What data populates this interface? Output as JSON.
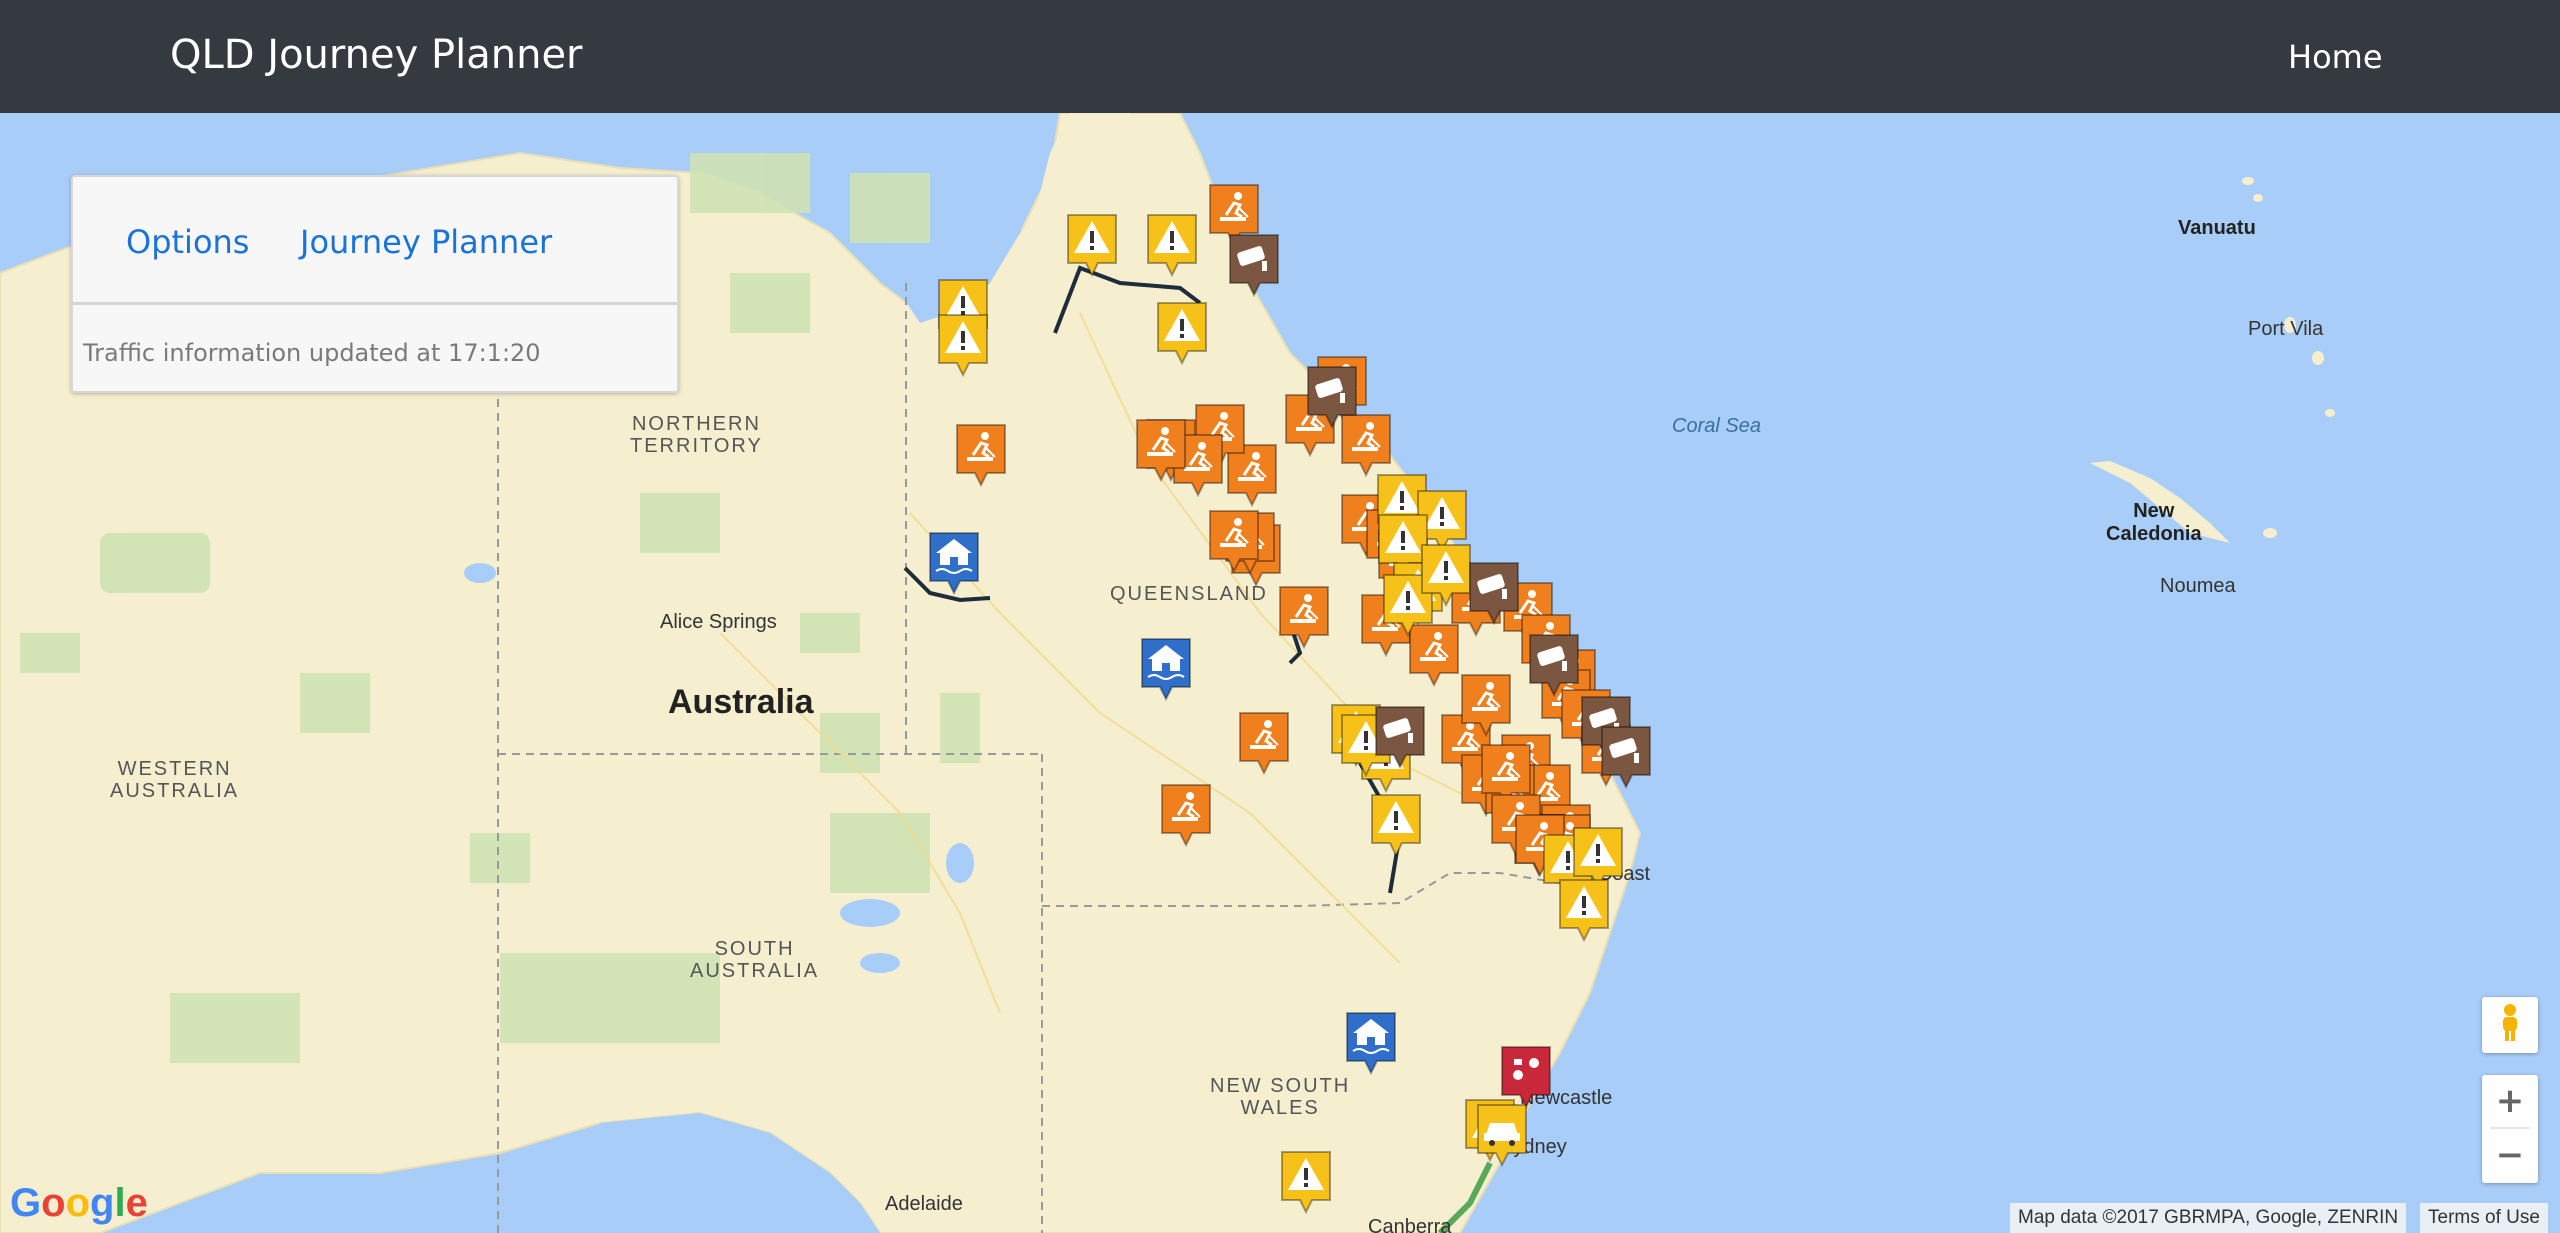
{
  "navbar": {
    "brand": "QLD Journey Planner",
    "home_label": "Home"
  },
  "panel": {
    "tabs": [
      {
        "label": "Options"
      },
      {
        "label": "Journey Planner"
      }
    ],
    "status_text": "Traffic information updated at 17:1:20"
  },
  "map": {
    "labels": {
      "northern_territory": "NORTHERN\nTERRITORY",
      "western_australia": "WESTERN\nAUSTRALIA",
      "south_australia": "SOUTH\nAUSTRALIA",
      "queensland": "QUEENSLAND",
      "new_south_wales": "NEW SOUTH\nWALES",
      "australia": "Australia",
      "alice_springs": "Alice Springs",
      "adelaide": "Adelaide",
      "canberra": "Canberra",
      "gold_coast": "Gold Coast",
      "newcastle": "Newcastle",
      "sydney": "Sydney",
      "coral_sea": "Coral Sea",
      "vanuatu": "Vanuatu",
      "port_vila": "Port Vila",
      "new_caledonia": "New\nCaledonia",
      "noumea": "Noumea"
    },
    "marker_colors": {
      "roadworks": "#f07f1e",
      "hazard": "#f6c21a",
      "camera": "#7b5640",
      "flooding": "#2f6fc9",
      "congestion": "#c8283a"
    },
    "markers": [
      {
        "type": "roadworks",
        "icon": "roadworks-icon"
      },
      {
        "type": "hazard",
        "icon": "warning-icon"
      },
      {
        "type": "camera",
        "icon": "traffic-camera-icon"
      },
      {
        "type": "flooding",
        "icon": "flood-house-icon"
      },
      {
        "type": "congestion",
        "icon": "congestion-icon"
      },
      {
        "type": "hazard",
        "icon": "car-crash-icon"
      }
    ],
    "controls": {
      "zoom_in": "+",
      "zoom_out": "−",
      "pegman_icon": "pegman-icon"
    },
    "google_logo": "Google",
    "attribution": "Map data ©2017 GBRMPA, Google, ZENRIN",
    "terms": "Terms of Use"
  }
}
